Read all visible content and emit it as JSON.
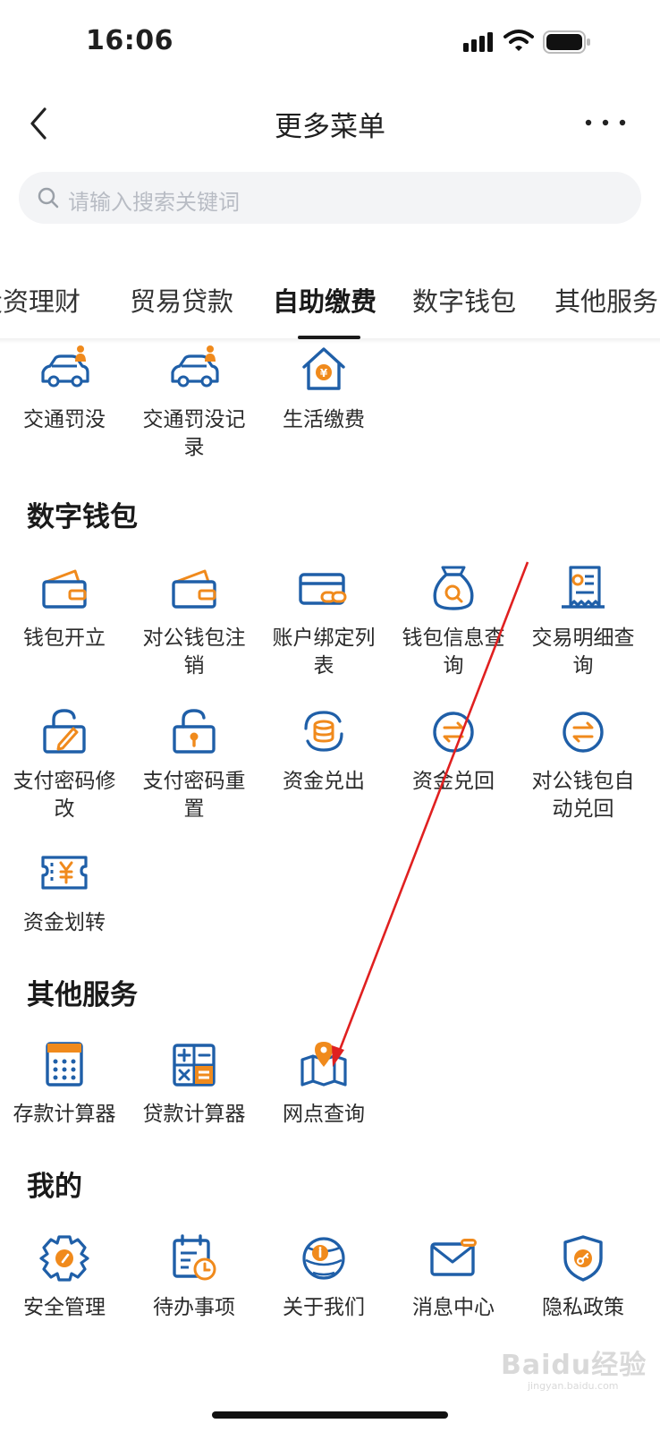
{
  "status_bar": {
    "time": "16:06"
  },
  "nav": {
    "title": "更多菜单"
  },
  "search": {
    "placeholder": "请输入搜索关键词"
  },
  "tabs": [
    "投资理财",
    "贸易贷款",
    "自助缴费",
    "数字钱包",
    "其他服务"
  ],
  "active_tab": "自助缴费",
  "self_payment": {
    "items": [
      {
        "label": "交通罚没",
        "icon": "car-fine-icon"
      },
      {
        "label": "交通罚没记录",
        "icon": "car-fine-record-icon"
      },
      {
        "label": "生活缴费",
        "icon": "house-yuan-icon"
      }
    ]
  },
  "digital_wallet": {
    "title": "数字钱包",
    "items": [
      {
        "label": "钱包开立",
        "icon": "wallet-icon"
      },
      {
        "label": "对公钱包注销",
        "icon": "wallet-cancel-icon"
      },
      {
        "label": "账户绑定列表",
        "icon": "card-link-icon"
      },
      {
        "label": "钱包信息查询",
        "icon": "money-bag-search-icon"
      },
      {
        "label": "交易明细查询",
        "icon": "receipt-icon"
      },
      {
        "label": "支付密码修改",
        "icon": "lock-edit-icon"
      },
      {
        "label": "支付密码重置",
        "icon": "lock-reset-icon"
      },
      {
        "label": "资金兑出",
        "icon": "coins-exchange-icon"
      },
      {
        "label": "资金兑回",
        "icon": "exchange-back-icon"
      },
      {
        "label": "对公钱包自动兑回",
        "icon": "auto-exchange-icon"
      },
      {
        "label": "资金划转",
        "icon": "transfer-ticket-icon"
      }
    ]
  },
  "other_services": {
    "title": "其他服务",
    "items": [
      {
        "label": "存款计算器",
        "icon": "deposit-calculator-icon"
      },
      {
        "label": "贷款计算器",
        "icon": "loan-calculator-icon"
      },
      {
        "label": "网点查询",
        "icon": "map-pin-icon"
      }
    ]
  },
  "mine": {
    "title": "我的",
    "items": [
      {
        "label": "安全管理",
        "icon": "security-gear-icon"
      },
      {
        "label": "待办事项",
        "icon": "calendar-todo-icon"
      },
      {
        "label": "关于我们",
        "icon": "info-globe-icon"
      },
      {
        "label": "消息中心",
        "icon": "mail-icon"
      },
      {
        "label": "隐私政策",
        "icon": "shield-icon"
      }
    ]
  },
  "watermark": {
    "main": "Baidu经验",
    "sub": "jingyan.baidu.com"
  },
  "colors": {
    "icon_blue": "#1f5fa8",
    "icon_orange": "#f08a1c",
    "annotation_red": "#e02020"
  }
}
